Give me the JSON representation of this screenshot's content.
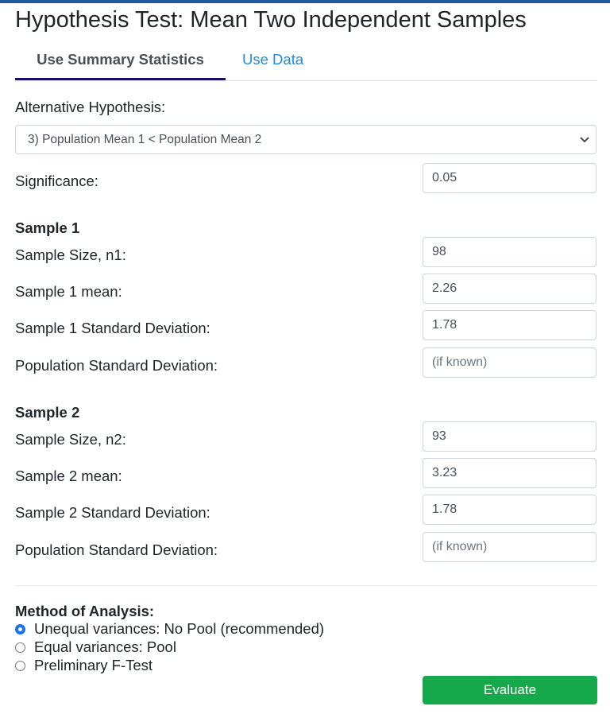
{
  "page": {
    "title": "Hypothesis Test: Mean Two Independent Samples"
  },
  "tabs": [
    {
      "label": "Use Summary Statistics",
      "active": true
    },
    {
      "label": "Use Data",
      "active": false
    }
  ],
  "alternative_hypothesis": {
    "label": "Alternative Hypothesis:",
    "selected": "3) Population Mean 1 < Population Mean 2",
    "icon": "chevron-down-icon"
  },
  "significance": {
    "label": "Significance:",
    "value": "0.05"
  },
  "sample1": {
    "heading": "Sample 1",
    "size_label": "Sample Size, n1:",
    "size_value": "98",
    "mean_label": "Sample 1 mean:",
    "mean_value": "2.26",
    "sd_label": "Sample 1 Standard Deviation:",
    "sd_value": "1.78",
    "pop_sd_label": "Population Standard Deviation:",
    "pop_sd_value": "",
    "pop_sd_placeholder": "(if known)"
  },
  "sample2": {
    "heading": "Sample 2",
    "size_label": "Sample Size, n2:",
    "size_value": "93",
    "mean_label": "Sample 2 mean:",
    "mean_value": "3.23",
    "sd_label": "Sample 2 Standard Deviation:",
    "sd_value": "1.78",
    "pop_sd_label": "Population Standard Deviation:",
    "pop_sd_value": "",
    "pop_sd_placeholder": "(if known)"
  },
  "method": {
    "heading": "Method of Analysis:",
    "options": [
      {
        "label": "Unequal variances: No Pool (recommended)",
        "checked": true
      },
      {
        "label": "Equal variances: Pool",
        "checked": false
      },
      {
        "label": "Preliminary F-Test",
        "checked": false
      }
    ]
  },
  "actions": {
    "evaluate_label": "Evaluate"
  },
  "colors": {
    "top_bar": "#1d5aa0",
    "active_tab_underline": "#1a0d6b",
    "link": "#1f8ae0",
    "evaluate_button": "#16a94b",
    "radio_checked": "#1a73e8"
  }
}
